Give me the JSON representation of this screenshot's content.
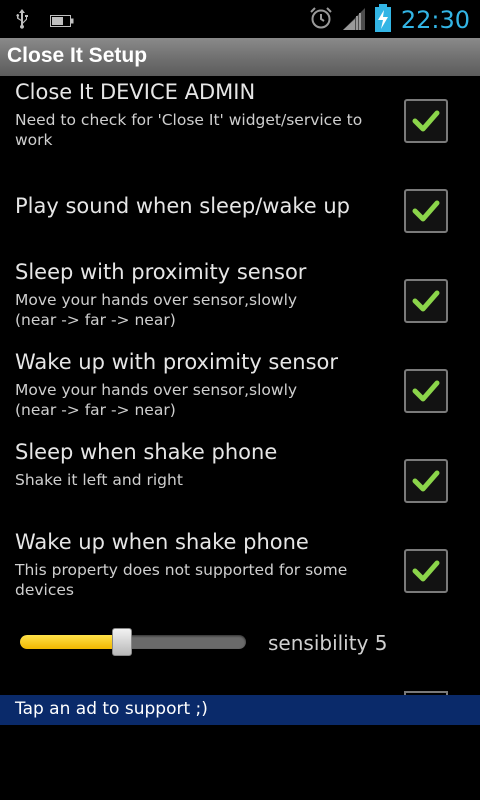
{
  "status_bar": {
    "time": "22:30",
    "icons": [
      "usb-icon",
      "battery-small-icon",
      "alarm-icon",
      "signal-icon",
      "battery-charging-icon"
    ]
  },
  "title_bar": {
    "title": "Close It Setup"
  },
  "preferences": [
    {
      "title": "Close It DEVICE ADMIN",
      "summary": "Need to check for 'Close It' widget/service to work",
      "checked": true
    },
    {
      "title": "Play sound when sleep/wake up",
      "summary": "",
      "checked": true
    },
    {
      "title": "Sleep with proximity sensor",
      "summary": "Move your hands over sensor,slowly\n(near -> far -> near)",
      "checked": true
    },
    {
      "title": "Wake up with proximity sensor",
      "summary": "Move your hands over sensor,slowly\n(near -> far -> near)",
      "checked": true
    },
    {
      "title": "Sleep when shake phone",
      "summary": "Shake it left and right",
      "checked": true
    },
    {
      "title": "Wake up when shake phone",
      "summary": "This property does not supported for some devices",
      "checked": true
    }
  ],
  "slider": {
    "label": "sensibility 5",
    "value_fraction": 0.45
  },
  "ad_bar": {
    "text": "Tap an ad to support ;)"
  },
  "colors": {
    "accent": "#33b5e5",
    "check": "#8bd54a",
    "ad_bg": "#0a2a6a",
    "slider_fill": "#f5c400"
  }
}
